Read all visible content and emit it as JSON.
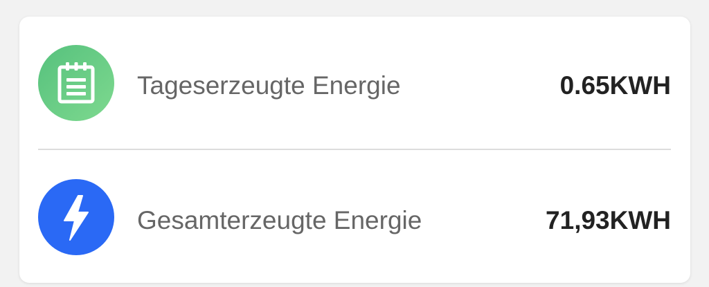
{
  "rows": [
    {
      "label": "Tageserzeugte Energie",
      "value": "0.65KWH",
      "icon": "clipboard-list-icon",
      "icon_color": "#5cc67f"
    },
    {
      "label": "Gesamterzeugte Energie",
      "value": "71,93KWH",
      "icon": "lightning-bolt-icon",
      "icon_color": "#2a69f5"
    }
  ]
}
